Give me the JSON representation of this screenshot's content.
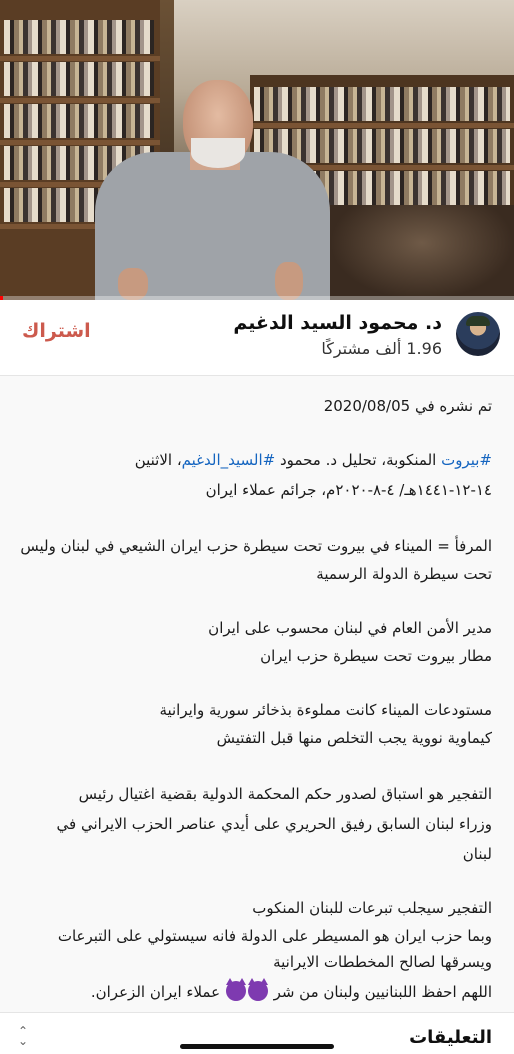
{
  "video": {
    "progress_percent": 0.6,
    "progress_color": "#ff0000"
  },
  "channel": {
    "name": "د. محمود السيد الدغيم",
    "subscribers": "1.96 ألف مشتركًا",
    "subscribe_label": "اشتراك",
    "subscribe_color": "#cc5a4d"
  },
  "description": {
    "published": "تم نشره في 2020/08/05",
    "hashtag_1": "#بيروت",
    "intro_text_1": " المنكوبة، تحليل د. محمود ",
    "hashtag_2": "#السيد_الدغيم",
    "intro_text_2": "، الاثنين",
    "intro_line_2": "١٤-١٢-١٤٤١هـ/ ٤-٨-٢٠٢٠م، جرائم عملاء ايران",
    "para_1_line_1": "المرفأ = الميناء في بيروت تحت سيطرة حزب ايران الشيعي في لبنان وليس",
    "para_1_line_2": "تحت سيطرة الدولة الرسمية",
    "para_2_line_1": "مدير الأمن العام في لبنان محسوب على ايران",
    "para_2_line_2": "مطار بيروت تحت سيطرة حزب ايران",
    "para_3_line_1": "مستودعات الميناء كانت مملوءة بذخائر سورية وايرانية",
    "para_3_line_2": "كيماوية نووية يجب التخلص منها قبل التفتيش",
    "para_4_line_1": "التفجير هو استباق لصدور حكم المحكمة الدولية بقضية اغتيال رئيس",
    "para_4_line_2": "وزراء لبنان السابق رفيق الحريري على أيدي عناصر الحزب الايراني في",
    "para_4_line_3": "لبنان",
    "para_5_line_1": "التفجير سيجلب تبرعات للبنان المنكوب",
    "para_5_line_2": "وبما حزب ايران هو المسيطر على الدولة فانه سيستولي على التبرعات",
    "para_5_line_3": "ويسرقها لصالح المخططات الايرانية",
    "para_5_line_4a": "اللهم احفظ اللبنانيين ولبنان من شر ",
    "para_5_line_4b": " عملاء ايران الزعران."
  },
  "comments": {
    "title": "التعليقات"
  },
  "icons": {
    "emoji": "purple-devil-emoji-icon",
    "expand": "unfold-icon"
  }
}
